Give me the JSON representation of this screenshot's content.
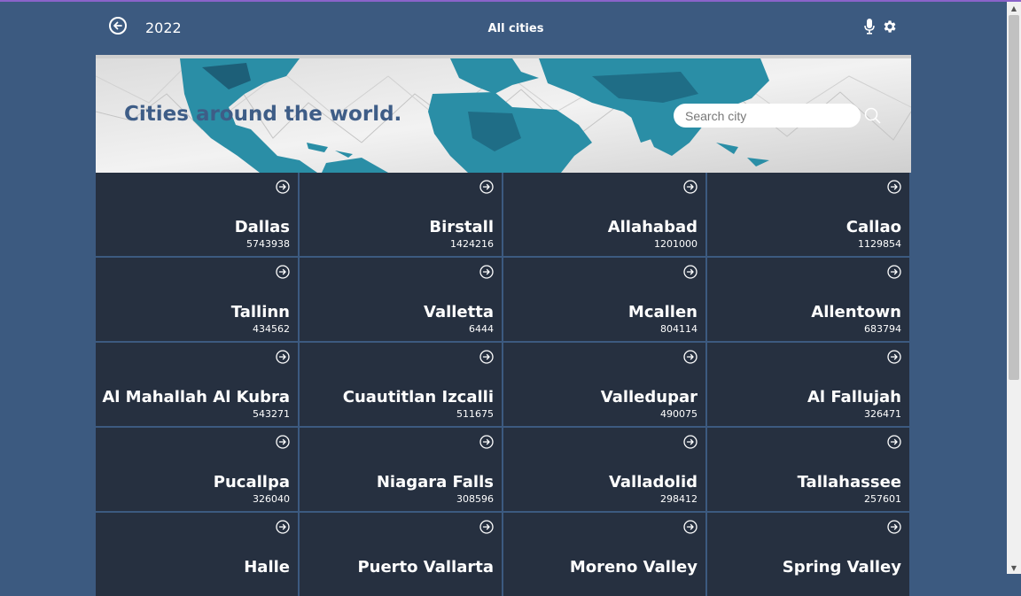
{
  "header": {
    "year": "2022",
    "title": "All cities",
    "back_icon": "arrow-left-circle-icon",
    "mic_icon": "microphone-icon",
    "settings_icon": "gear-icon"
  },
  "banner": {
    "tagline": "Cities around the world.",
    "search_placeholder": "Search city"
  },
  "cities": [
    {
      "name": "Dallas",
      "population": "5743938"
    },
    {
      "name": "Birstall",
      "population": "1424216"
    },
    {
      "name": "Allahabad",
      "population": "1201000"
    },
    {
      "name": "Callao",
      "population": "1129854"
    },
    {
      "name": "Tallinn",
      "population": "434562"
    },
    {
      "name": "Valletta",
      "population": "6444"
    },
    {
      "name": "Mcallen",
      "population": "804114"
    },
    {
      "name": "Allentown",
      "population": "683794"
    },
    {
      "name": "Al Mahallah Al Kubra",
      "population": "543271"
    },
    {
      "name": "Cuautitlan Izcalli",
      "population": "511675"
    },
    {
      "name": "Valledupar",
      "population": "490075"
    },
    {
      "name": "Al Fallujah",
      "population": "326471"
    },
    {
      "name": "Pucallpa",
      "population": "326040"
    },
    {
      "name": "Niagara Falls",
      "population": "308596"
    },
    {
      "name": "Valladolid",
      "population": "298412"
    },
    {
      "name": "Tallahassee",
      "population": "257601"
    },
    {
      "name": "Halle",
      "population": ""
    },
    {
      "name": "Puerto Vallarta",
      "population": ""
    },
    {
      "name": "Moreno Valley",
      "population": ""
    },
    {
      "name": "Spring Valley",
      "population": ""
    }
  ],
  "colors": {
    "page_bg": "#3c5a80",
    "card_bg": "#263040",
    "tagline": "#3e5d87",
    "map_land": "#2a8ea6"
  }
}
